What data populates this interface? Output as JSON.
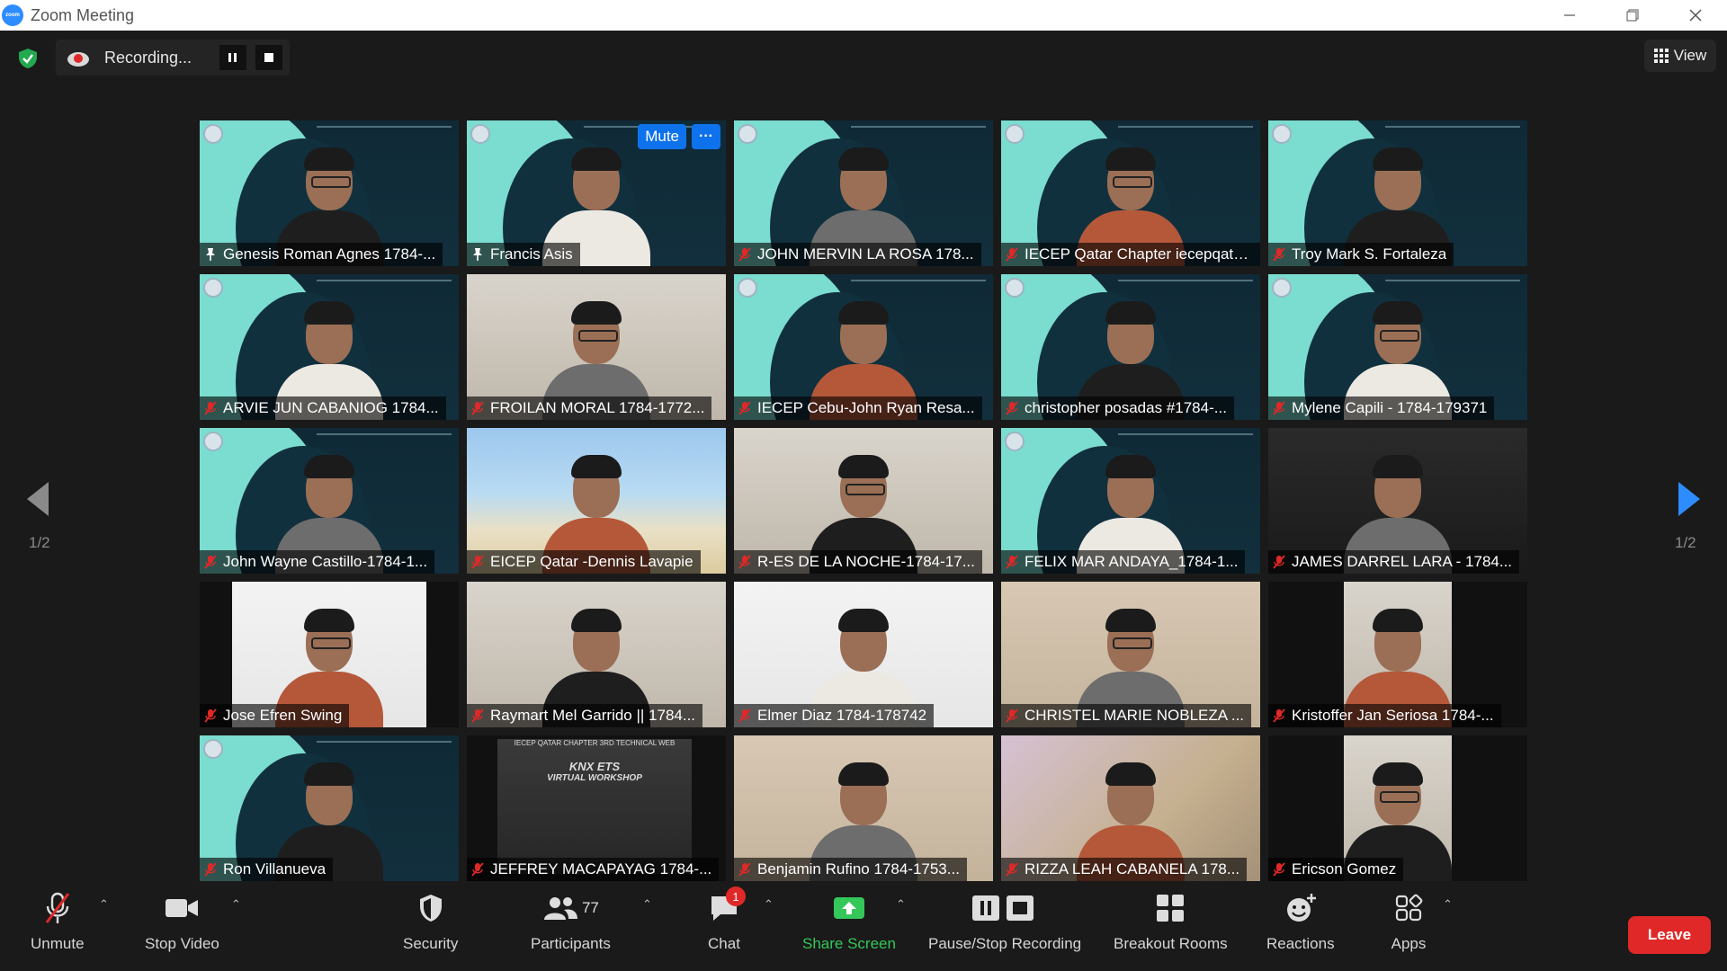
{
  "window": {
    "title": "Zoom Meeting",
    "app_icon_text": "zoom"
  },
  "recording": {
    "status": "Recording..."
  },
  "view_button": {
    "label": "View"
  },
  "pagination": {
    "left": "1/2",
    "right": "1/2"
  },
  "hover_controls": {
    "mute": "Mute",
    "more": "···"
  },
  "participants": [
    {
      "name": "Genesis Roman Agnes 1784-...",
      "bg": "webinar",
      "status": "host"
    },
    {
      "name": "Francis Asis",
      "bg": "webinar",
      "status": "host"
    },
    {
      "name": "JOHN MERVIN LA ROSA 178...",
      "bg": "webinar",
      "status": "muted"
    },
    {
      "name": "IECEP Qatar Chapter iecepqatar...",
      "bg": "webinar",
      "status": "muted",
      "active": true
    },
    {
      "name": "Troy Mark S. Fortaleza",
      "bg": "webinar",
      "status": "muted"
    },
    {
      "name": "ARVIE JUN CABANIOG 1784...",
      "bg": "webinar",
      "status": "muted"
    },
    {
      "name": "FROILAN MORAL 1784-1772...",
      "bg": "room",
      "status": "muted"
    },
    {
      "name": "IECEP Cebu-John Ryan Resa...",
      "bg": "webinar",
      "status": "muted"
    },
    {
      "name": "christopher posadas #1784-...",
      "bg": "webinar",
      "status": "muted"
    },
    {
      "name": "Mylene Capili - 1784-179371",
      "bg": "webinar",
      "status": "muted"
    },
    {
      "name": "John Wayne Castillo-1784-1...",
      "bg": "webinar",
      "status": "muted"
    },
    {
      "name": "EICEP Qatar -Dennis Lavapie",
      "bg": "beach",
      "status": "muted"
    },
    {
      "name": "R-ES DE LA NOCHE-1784-17...",
      "bg": "room",
      "status": "muted"
    },
    {
      "name": "FELIX MAR ANDAYA_1784-1...",
      "bg": "webinar",
      "status": "muted"
    },
    {
      "name": "JAMES DARREL LARA - 1784...",
      "bg": "dark",
      "status": "muted"
    },
    {
      "name": "Jose Efren Swing",
      "bg": "bright",
      "status": "muted"
    },
    {
      "name": "Raymart Mel Garrido || 1784...",
      "bg": "room",
      "status": "muted"
    },
    {
      "name": "Elmer Diaz  1784-178742",
      "bg": "bright",
      "status": "muted"
    },
    {
      "name": "CHRISTEL MARIE NOBLEZA ...",
      "bg": "warm",
      "status": "muted"
    },
    {
      "name": "Kristoffer Jan Seriosa  1784-...",
      "bg": "room",
      "status": "muted"
    },
    {
      "name": "Ron Villanueva",
      "bg": "webinar",
      "status": "muted"
    },
    {
      "name": "JEFFREY MACAPAYAG 1784-...",
      "bg": "poster",
      "status": "muted"
    },
    {
      "name": "Benjamin Rufino 1784-1753...",
      "bg": "warm",
      "status": "muted"
    },
    {
      "name": "RIZZA LEAH CABANELA 178...",
      "bg": "blur",
      "status": "muted"
    },
    {
      "name": "Ericson Gomez",
      "bg": "room",
      "status": "muted"
    }
  ],
  "poster": {
    "header": "IECEP QATAR CHAPTER 3RD TECHNICAL WEB",
    "title": "KNX ETS",
    "subtitle": "VIRTUAL WORKSHOP"
  },
  "toolbar": {
    "unmute": "Unmute",
    "stop_video": "Stop Video",
    "security": "Security",
    "participants": "Participants",
    "participants_count": "77",
    "chat": "Chat",
    "chat_badge": "1",
    "share_screen": "Share Screen",
    "pause_stop_recording": "Pause/Stop Recording",
    "breakout_rooms": "Breakout Rooms",
    "reactions": "Reactions",
    "apps": "Apps",
    "leave": "Leave"
  },
  "colors": {
    "accent_blue": "#0e72ed",
    "share_green": "#34c759",
    "leave_red": "#e02828",
    "active_speaker": "#d8e36a"
  }
}
